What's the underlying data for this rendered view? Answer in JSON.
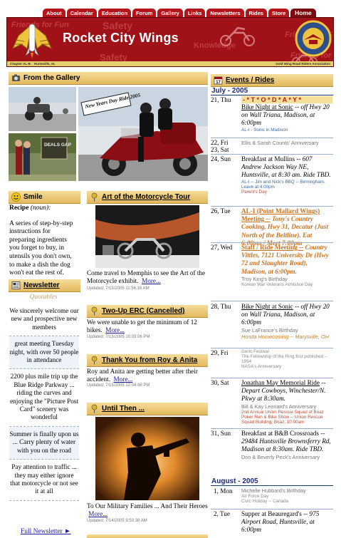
{
  "nav": {
    "tabs": [
      "About",
      "Calendar",
      "Education",
      "Forum",
      "Gallery",
      "Links",
      "Newsletters",
      "Rides",
      "Store",
      "Home"
    ]
  },
  "header": {
    "site_title": "Rocket City Wings",
    "chapter": "Chapter AL-B",
    "city": "Huntsville, AL",
    "association": "Gold Wing Road Riders Association",
    "watermarks": [
      "Friends for Fun",
      "Safety",
      "Friends for Fun",
      "Knowledge",
      "Safety",
      "Friends for Fun"
    ]
  },
  "gallery": {
    "heading": "From the Gallery",
    "banner_text": "New Years Day Ride 2005",
    "sign_text": "DEALS GAP"
  },
  "smile": {
    "heading": "Smile",
    "term": "Recipe",
    "pos": "(noun):",
    "definition": "A series of step-by-step instructions for preparing ingredients you forget to buy, in utensils you don't own, to make a dish the dog won't eat the rest of."
  },
  "newsletter": {
    "heading": "Newsletter",
    "quotables_label": "Quotables",
    "quotes": [
      "We sincerely welcome our new and prospective new members",
      "great meeting Tuesday night, with over 50 people in attendance",
      "2200 plus mile trip up the Blue Ridge Parkway ... riding the curves and enjoying the \"Picture Post Card\" scenery was wonderful",
      "Summer is finally upon us ... Carry plenty of water with you on the road",
      "Pay attention to traffic ... they may either ignore that motorcycle or not see it at all"
    ],
    "full_link": "Full Newsletter ►"
  },
  "articles": [
    {
      "title": "Art of the Motorcycle Tour",
      "body": "Come travel to Memphis to see the Art of the Motorcycle exhibit.",
      "more": "More...",
      "updated": "Updated: 7/15/2005 11:56:16 AM"
    },
    {
      "title": "Two-Up ERC (Cancelled)",
      "body": "We were unable to get the minimum of 12 bikes.",
      "more": "More...",
      "updated": "Updated: 7/15/2005 10:03:06 PM"
    },
    {
      "title": "Thank You from Roy & Anita",
      "body": "Roy and Anita are getting better after their accident.",
      "more": "More...",
      "updated": "Updated: 7/15/2005 12:04:48 PM"
    },
    {
      "title": "Until Then ...",
      "body": "To Our Military Families ... And Their Heroes",
      "more": "More...",
      "updated": "Updated: 7/14/2005 9:50:38 AM"
    }
  ],
  "events": {
    "heading": "Events / Rides",
    "month1": "July - 2005",
    "month2": "August - 2005",
    "items": [
      {
        "date": "21, Thu",
        "todays": "- * T * O * D * A * Y *",
        "link": "Bike Night at Sonic",
        "desc": " -- off Hwy 20 on Wall Triana, Madison, at 6:00pm",
        "notes": [
          "AL-I - Sonic in Madison"
        ]
      },
      {
        "date": "22, Fri",
        "date2": "23, Sat",
        "grey": "Ellis & Sarah Counts' Anniversary"
      },
      {
        "date": "24, Sun",
        "main": "Breakfast at Mullins",
        "desc": " -- 607 Andrew Jackson Way NE, Huntsville, at 8:30 am. Ride TBD.",
        "notes": [
          "AL-I -- Jim and Nick's BBQ -- Birmingham. Leave at 4:00pm",
          "Parent's Day"
        ]
      },
      {
        "date": "26, Tue",
        "orange_link": "AL-I (Point Mallard Wings) Meeting --",
        "desc": " Tony's Country Cooking, Hwy 31, Decatur (Just North of the Beltline). Eat 6:00pm / Meet 7:00pm"
      },
      {
        "date": "27, Wed",
        "orange_link": "Staff / Ride Meeting --",
        "desc": " Country Vittles, 7121 University Dr (Hwy 72 and Slaughter Road), Madison, at 6:00pm.",
        "grey": [
          "Troy King's Birthday"
        ],
        "notes": [
          "Korean War Veterans Armistice Day"
        ]
      },
      {
        "date": "28, Thu",
        "link": "Bike Night at Sonic",
        "desc": " -- off Hwy 20 on Wall Triana, Madison, at 6:00pm",
        "grey": [
          "Sue LaFrance's Birthday"
        ],
        "orange": "Honda Homecoming -- Marysville, OH"
      },
      {
        "date": "29, Fri",
        "notes": [
          "Gerlo Festival",
          "The Fellowship of the Ring first published -- 1954",
          "NASA's Anniversary"
        ]
      },
      {
        "date": "30, Sat",
        "link": "Jonathan May Memorial Ride",
        "desc": " -- Depart Cowboys, Winchester/N. Pkwy at 8:30am.",
        "grey": [
          "Bill & Kay Leonard's Anniversary"
        ],
        "red_notes": [
          "2nd Annual Union Rescue Squad of Boaz Poker Run & Bike Show -- Union Rescue Squad Building, Boaz, 10:00am"
        ]
      },
      {
        "date": "31, Sun",
        "main": "Breakfast at B&B Crossroads",
        "desc": " -- 29484 Huntsville Brownsferry Rd, Madison at 8:30am. Ride TBD.",
        "grey": [
          "Don & Beverly Peck's Anniversary"
        ]
      },
      {
        "date": "1, Mon",
        "grey": [
          "Michelle Hubbard's Birthday"
        ],
        "notes": [
          "Air Force Day",
          "Civic Holiday -- Canada"
        ]
      },
      {
        "date": "2, Tue",
        "main": "Supper at Beauregard's",
        "desc": " -- 975 Airport Road, Huntsville, at 6:00pm"
      }
    ]
  }
}
